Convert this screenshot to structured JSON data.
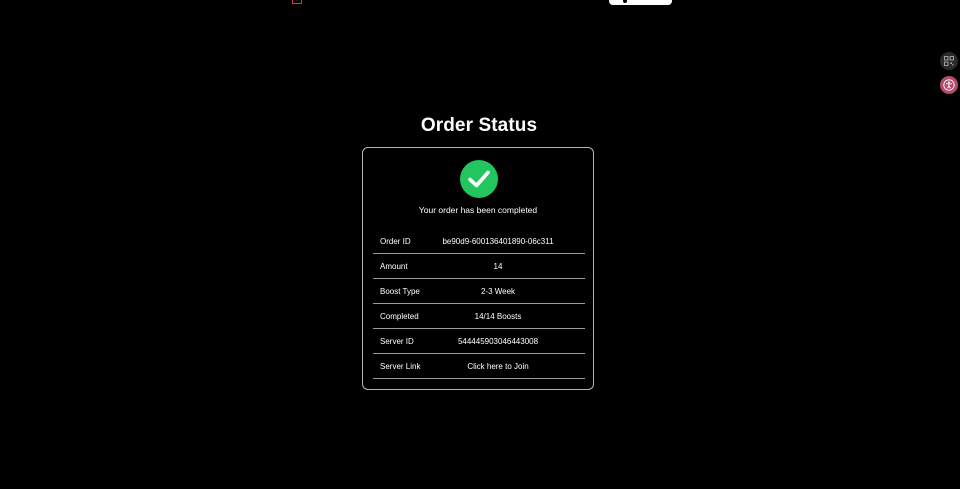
{
  "page": {
    "title": "Order Status"
  },
  "status": {
    "icon": "check-circle-icon",
    "message": "Your order has been completed",
    "color": "#22c55e"
  },
  "details": [
    {
      "label": "Order ID",
      "value": "be90d9-600136401890-06c311"
    },
    {
      "label": "Amount",
      "value": "14"
    },
    {
      "label": "Boost Type",
      "value": "2-3 Week"
    },
    {
      "label": "Completed",
      "value": "14/14 Boosts"
    },
    {
      "label": "Server ID",
      "value": "544445903046443008"
    },
    {
      "label": "Server Link",
      "value": "Click here to Join"
    }
  ],
  "colors": {
    "background": "#000000",
    "card_border": "#b5b5b5",
    "divider": "#9a9a9a",
    "text": "#ffffff"
  },
  "side_buttons": [
    {
      "icon": "qr-code-icon"
    },
    {
      "icon": "accessibility-icon"
    }
  ]
}
